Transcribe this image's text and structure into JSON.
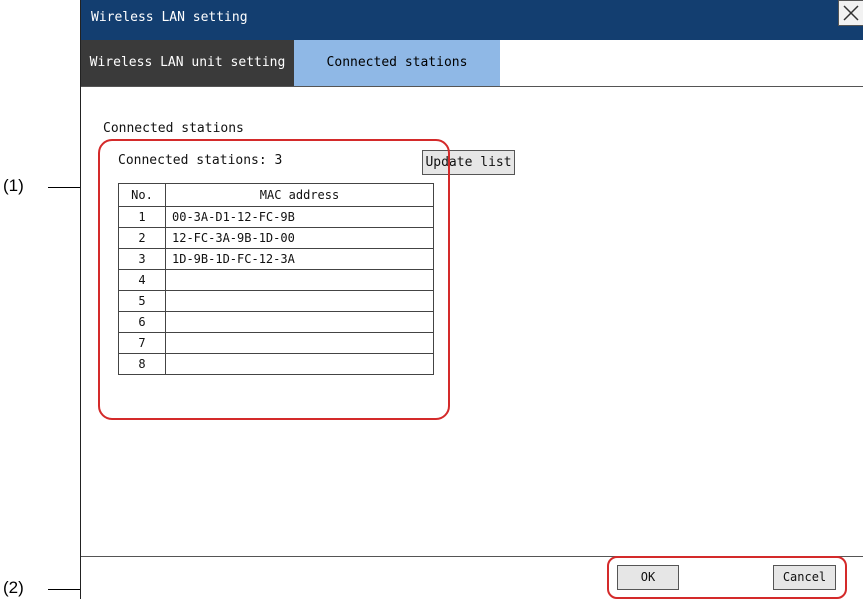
{
  "callouts": {
    "c1": "(1)",
    "c2": "(2)"
  },
  "window": {
    "title": "Wireless LAN setting"
  },
  "tabs": [
    {
      "label": "Wireless LAN unit setting"
    },
    {
      "label": "Connected stations"
    }
  ],
  "main": {
    "section_title": "Connected stations",
    "count_label": "Connected stations: 3",
    "update_button": "Update list",
    "table": {
      "headers": [
        "No.",
        "MAC address"
      ],
      "rows": [
        {
          "no": "1",
          "mac": "00-3A-D1-12-FC-9B"
        },
        {
          "no": "2",
          "mac": "12-FC-3A-9B-1D-00"
        },
        {
          "no": "3",
          "mac": "1D-9B-1D-FC-12-3A"
        },
        {
          "no": "4",
          "mac": ""
        },
        {
          "no": "5",
          "mac": ""
        },
        {
          "no": "6",
          "mac": ""
        },
        {
          "no": "7",
          "mac": ""
        },
        {
          "no": "8",
          "mac": ""
        }
      ]
    }
  },
  "footer": {
    "ok": "OK",
    "cancel": "Cancel"
  },
  "colors": {
    "titlebar": "#133e70",
    "active_tab": "#8fb8e6",
    "inactive_tab": "#3a3a3a",
    "callout": "#d42a2a"
  },
  "icons": {
    "close": "close-icon"
  }
}
